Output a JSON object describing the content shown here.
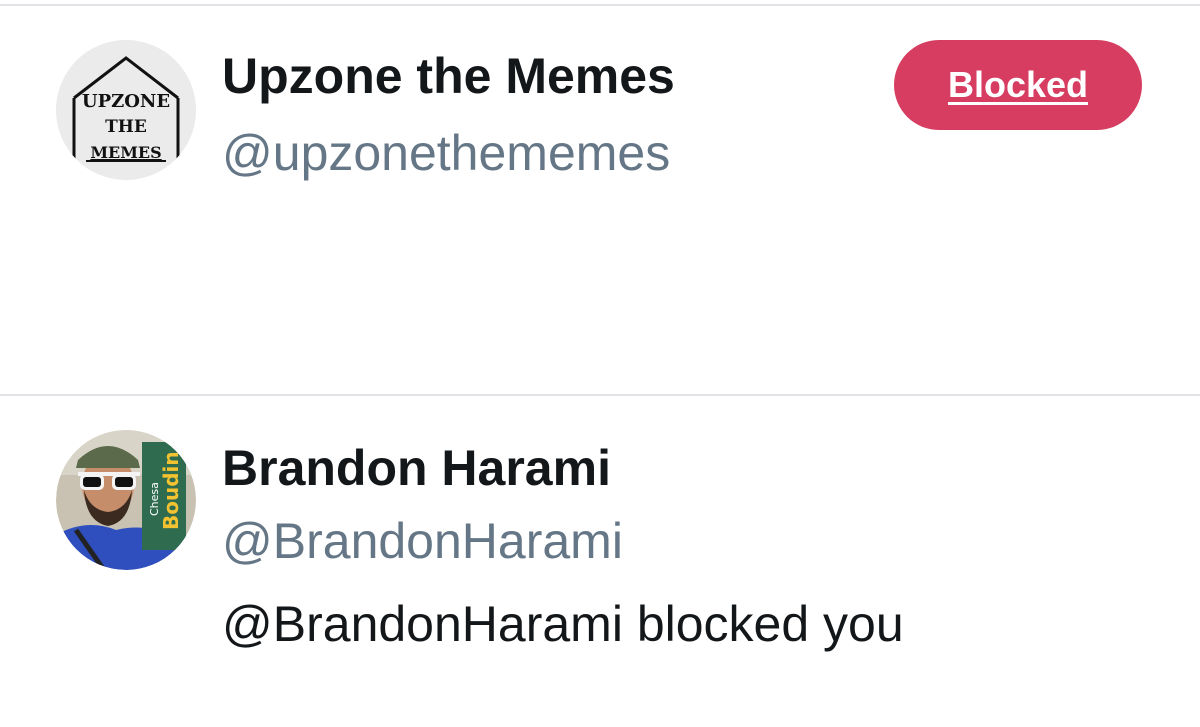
{
  "accounts": [
    {
      "display_name": "Upzone the Memes",
      "handle": "@upzonethememes",
      "action_label": "Blocked",
      "avatar_icon": "upzone-logo-avatar",
      "avatar_text": [
        "UPZONE",
        "THE",
        "MEMES"
      ]
    },
    {
      "display_name": "Brandon Harami",
      "handle": "@BrandonHarami",
      "status": "@BrandonHarami blocked you",
      "avatar_icon": "user-photo-avatar",
      "avatar_text": [
        "Chesa",
        "Boudin"
      ]
    }
  ],
  "colors": {
    "blocked_button": "#d63d61",
    "handle_gray": "#657786",
    "divider": "#e1e3e6"
  }
}
